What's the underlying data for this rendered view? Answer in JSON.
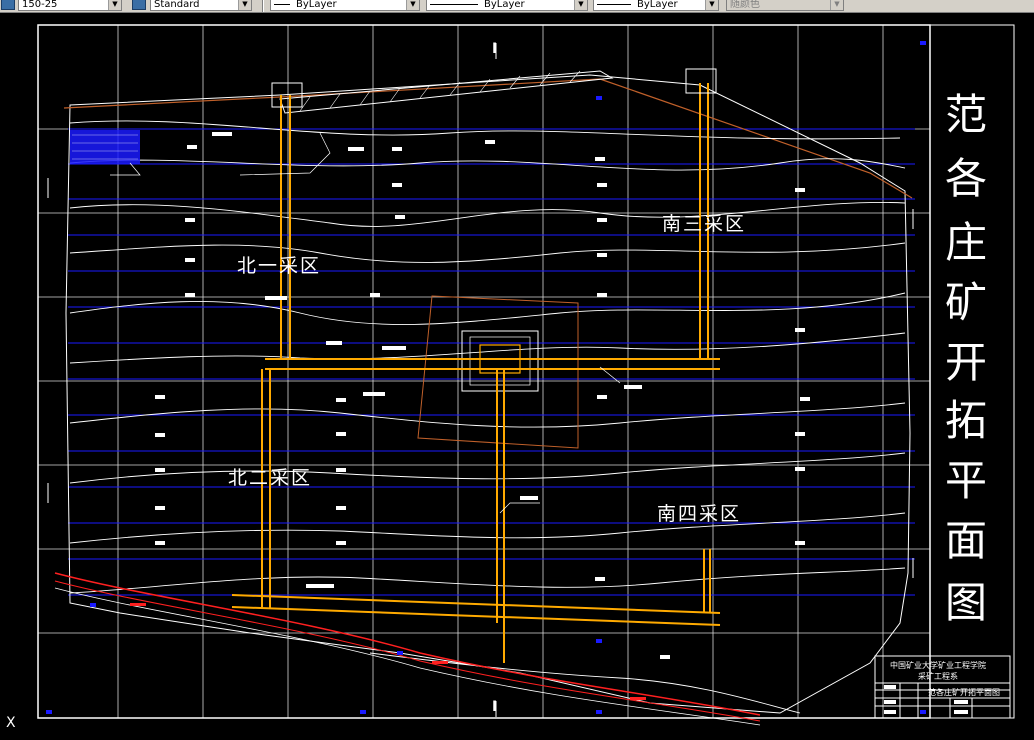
{
  "toolbar": {
    "text_style": "150-25",
    "dim_style": "Standard",
    "layer": "ByLayer",
    "linetype": "ByLayer",
    "lineweight": "ByLayer",
    "plot_style": "随颜色"
  },
  "drawing": {
    "title_chars": [
      "范",
      "各",
      "庄",
      "矿",
      "开",
      "拓",
      "平",
      "面",
      "图"
    ],
    "zones": {
      "north1": "北一采区",
      "north2": "北二采区",
      "south3": "南三采区",
      "south4": "南四采区"
    },
    "section_mark_top": "I",
    "section_mark_bottom": "I",
    "ucs_label": "X",
    "title_block": {
      "institution": "中国矿业大学矿业工程学院",
      "department": "采矿工程系",
      "drawing_name": "范各庄矿开拓平面图"
    }
  },
  "colors": {
    "background": "#000000",
    "grid": "#ffffff",
    "seam_lines": "#0000ff",
    "roadway": "#ffaa00",
    "boundary": "#c0602a",
    "rail": "#ff2020"
  }
}
